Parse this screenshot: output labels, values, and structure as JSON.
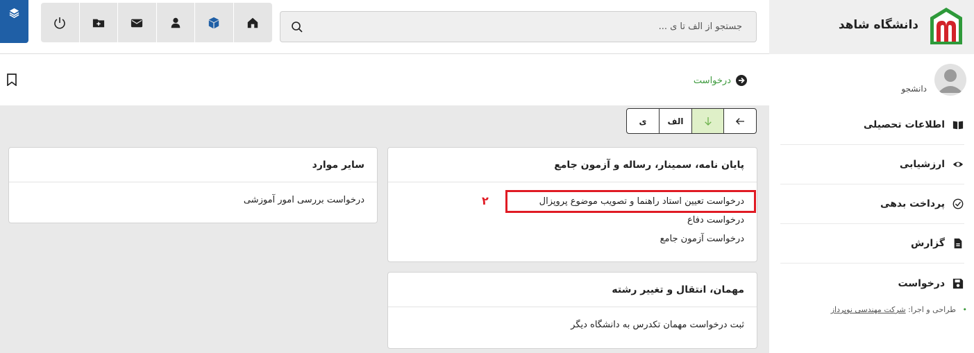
{
  "brand": {
    "title": "دانشگاه شاهد",
    "logo_icon": "shahed-university-logo",
    "colors": {
      "logo_green": "#2e9a3a",
      "logo_red": "#d2232a"
    }
  },
  "user": {
    "role": "دانشجو",
    "avatar_icon": "user-avatar-icon"
  },
  "sidebar": {
    "items": [
      {
        "label": "اطلاعات تحصیلی",
        "icon": "book-open-icon"
      },
      {
        "label": "ارزشیابی",
        "icon": "eye-icon"
      },
      {
        "label": "پرداخت بدهی",
        "icon": "check-circle-icon"
      },
      {
        "label": "گزارش",
        "icon": "file-text-icon"
      },
      {
        "label": "درخواست",
        "icon": "save-floppy-icon"
      }
    ]
  },
  "footer": {
    "prefix": "طراحی و اجرا:",
    "company": "شرکت مهندسی نوپرداز"
  },
  "toolbar": {
    "icons": [
      "power-icon",
      "folder-plus-icon",
      "envelope-icon",
      "user-icon",
      "cube-icon",
      "home-icon"
    ],
    "layers_icon": "layers-icon",
    "accent": "#1f5fa6"
  },
  "search": {
    "placeholder": "جستجو از الف تا ی ...",
    "value": ""
  },
  "breadcrumb": {
    "label": "درخواست",
    "icon": "arrow-circle-right-icon",
    "color": "#3d9a3d"
  },
  "sort": {
    "ye": "ی",
    "alef": "الف",
    "down_icon": "arrow-down-icon",
    "back_icon": "arrow-left-icon"
  },
  "cards": {
    "thesis": {
      "title": "پایان نامه، سمینار، رساله و آزمون جامع",
      "items": [
        "درخواست تعیین استاد راهنما و تصویب موضوع پروپزال",
        "درخواست دفاع",
        "درخواست آزمون جامع"
      ]
    },
    "other": {
      "title": "سایر موارد",
      "items": [
        "درخواست بررسی امور آموزشی"
      ]
    },
    "transfer": {
      "title": "مهمان، انتقال و تغییر رشته",
      "items": [
        "ثبت درخواست مهمان تکدرس به دانشگاه دیگر"
      ]
    }
  },
  "annotation": {
    "step": "۲",
    "color": "#e01b24"
  }
}
